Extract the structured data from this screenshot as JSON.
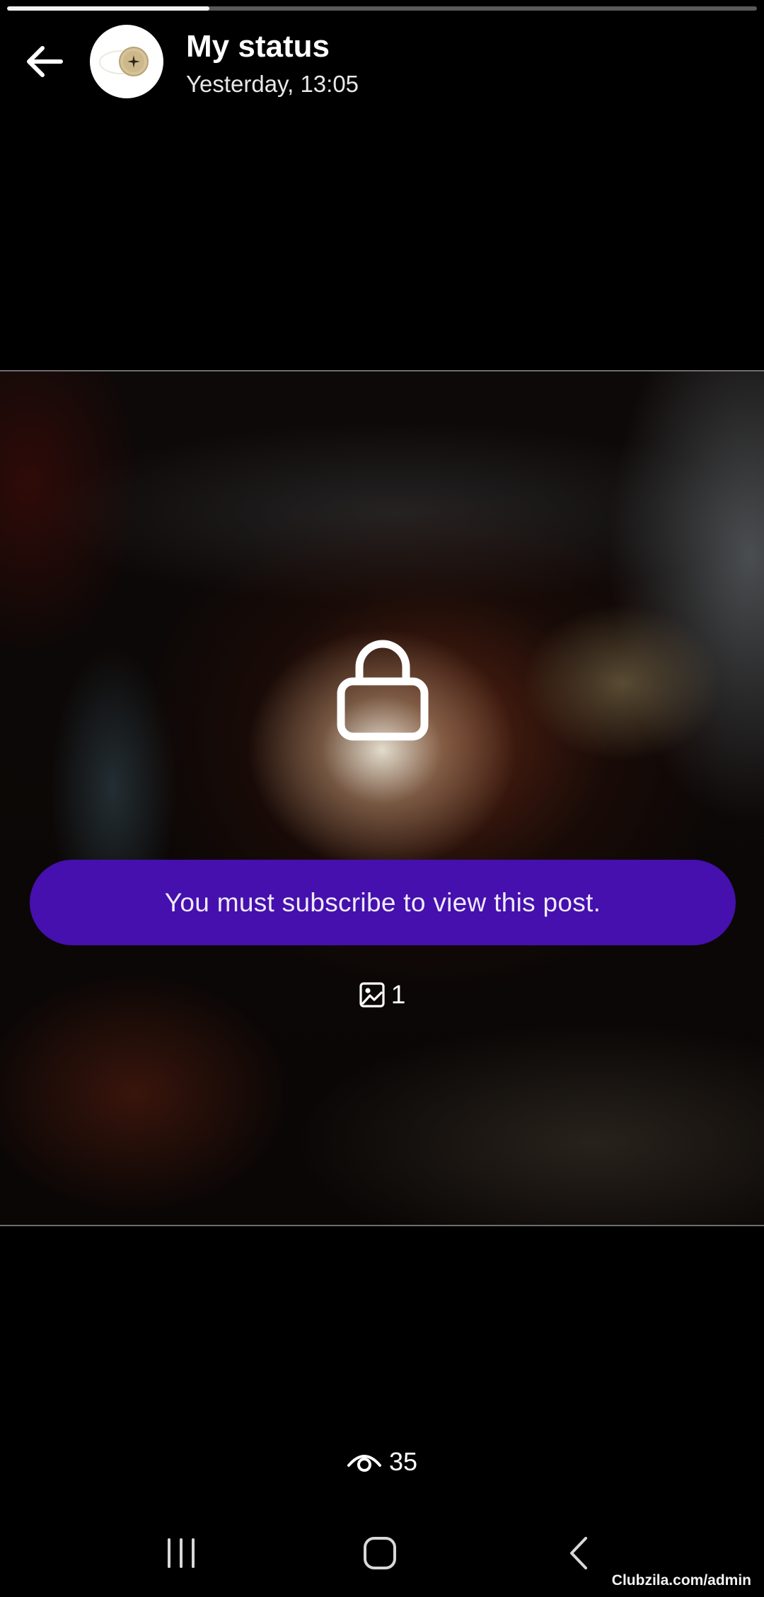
{
  "progress": {
    "fraction": 0.27
  },
  "header": {
    "back_icon": "arrow-left-icon",
    "avatar_icon": "compass-star-logo",
    "title": "My status",
    "time": "Yesterday, 13:05"
  },
  "media": {
    "lock_icon": "lock-icon",
    "subscribe_label": "You must subscribe to view this post.",
    "image_icon": "image-icon",
    "image_count": "1"
  },
  "footer": {
    "views_icon": "eye-icon",
    "views_count": "35"
  },
  "navbar": {
    "recents_icon": "recents-icon",
    "home_icon": "home-icon",
    "back_icon": "back-chevron-icon"
  },
  "watermark": "Clubzila.com/admin",
  "colors": {
    "accent": "#4510ad",
    "background": "#000000",
    "progress_track": "#5a5a5a",
    "progress_fill": "#f2f2f2"
  }
}
